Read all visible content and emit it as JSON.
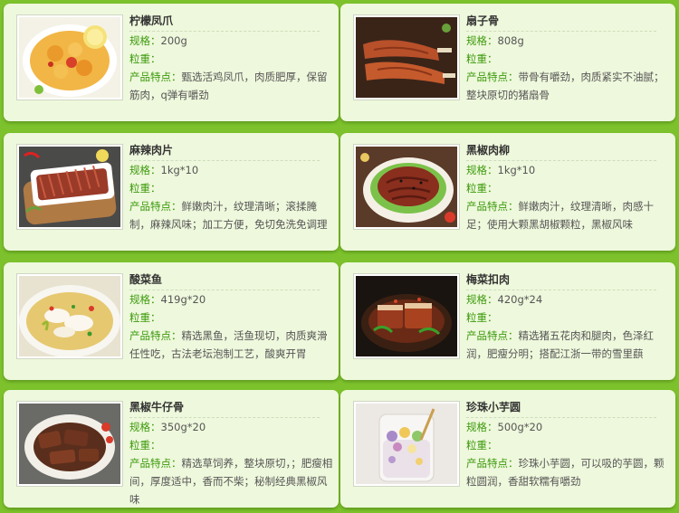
{
  "products": [
    {
      "name": "柠檬凤爪",
      "spec_label": "规格：",
      "spec": "200g",
      "weight_label": "粒重：",
      "weight": "",
      "feature_label": "产品特点：",
      "feature": "甄选活鸡凤爪，肉质肥厚，保留筋肉，q弹有嚼劲",
      "image": "lemon-chicken-feet"
    },
    {
      "name": "扇子骨",
      "spec_label": "规格：",
      "spec": "808g",
      "weight_label": "粒重：",
      "weight": "",
      "feature_label": "产品特点：",
      "feature": "带骨有嚼劲，肉质紧实不油腻；整块原切的猪扇骨",
      "image": "pork-fan-bone"
    },
    {
      "name": "麻辣肉片",
      "spec_label": "规格：",
      "spec": "1kg*10",
      "weight_label": "粒重：",
      "weight": "",
      "feature_label": "产品特点：",
      "feature": "鲜嫩肉汁，纹理清晰；滚揉腌制，麻辣风味；加工方便，免切免洗免调理",
      "image": "spicy-meat-slices"
    },
    {
      "name": "黑椒肉柳",
      "spec_label": "规格：",
      "spec": "1kg*10",
      "weight_label": "粒重：",
      "weight": "",
      "feature_label": "产品特点：",
      "feature": "鲜嫩肉汁，纹理清晰，肉感十足；使用大颗黑胡椒颗粒，黑椒风味",
      "image": "black-pepper-meat-strips"
    },
    {
      "name": "酸菜鱼",
      "spec_label": "规格：",
      "spec": "419g*20",
      "weight_label": "粒重：",
      "weight": "",
      "feature_label": "产品特点：",
      "feature": "精选黑鱼，活鱼现切，肉质爽滑任性吃，古法老坛泡制工艺，酸爽开胃",
      "image": "pickled-cabbage-fish"
    },
    {
      "name": "梅菜扣肉",
      "spec_label": "规格：",
      "spec": "420g*24",
      "weight_label": "粒重：",
      "weight": "",
      "feature_label": "产品特点：",
      "feature": "精选猪五花肉和腿肉，色泽红润，肥瘦分明；搭配江浙一带的雪里蕻",
      "image": "braised-pork-preserved-vegetable"
    },
    {
      "name": "黑椒牛仔骨",
      "spec_label": "规格：",
      "spec": "350g*20",
      "weight_label": "粒重：",
      "weight": "",
      "feature_label": "产品特点：",
      "feature": "精选草饲养，整块原切，；肥瘦相间，厚度适中，香而不柴；秘制经典黑椒风味",
      "image": "black-pepper-beef-ribs"
    },
    {
      "name": "珍珠小芋圆",
      "spec_label": "规格：",
      "spec": "500g*20",
      "weight_label": "粒重：",
      "weight": "",
      "feature_label": "产品特点：",
      "feature": "珍珠小芋圆，可以吸的芋圆，颗粒圆润，香甜软糯有嚼劲",
      "image": "taro-balls-dessert"
    }
  ]
}
